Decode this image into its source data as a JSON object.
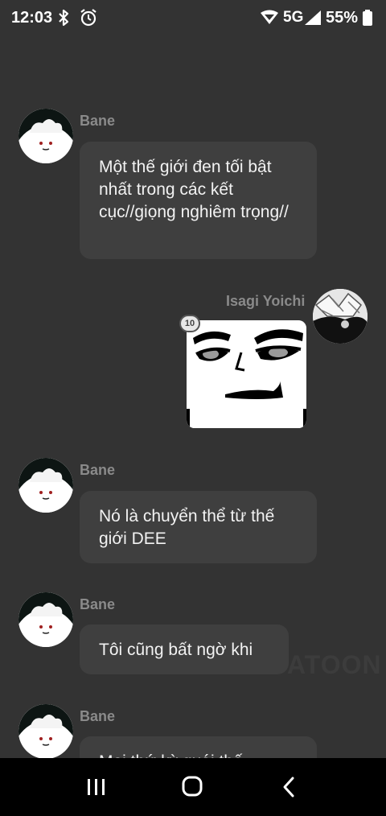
{
  "status_bar": {
    "time": "12:03",
    "network": "5G",
    "network_sub": "G",
    "battery": "55%"
  },
  "messages": [
    {
      "sender": "Bane",
      "text": "Một thế giới đen tối bật nhất trong các kết cục//giọng nghiêm trọng//"
    },
    {
      "sender": "Isagi Yoichi",
      "sticker": "face-sticker",
      "badge": "10"
    },
    {
      "sender": "Bane",
      "text": "Nó là chuyển thể từ thế giới DEE"
    },
    {
      "sender": "Bane",
      "text": "Tôi cũng bất ngờ khi"
    },
    {
      "sender": "Bane",
      "text": "Mọi thứ kỳ quái thế"
    }
  ],
  "watermark": "ATOON",
  "nav": {
    "recents_icon": "recents-icon",
    "home_icon": "home-icon",
    "back_icon": "back-icon"
  }
}
